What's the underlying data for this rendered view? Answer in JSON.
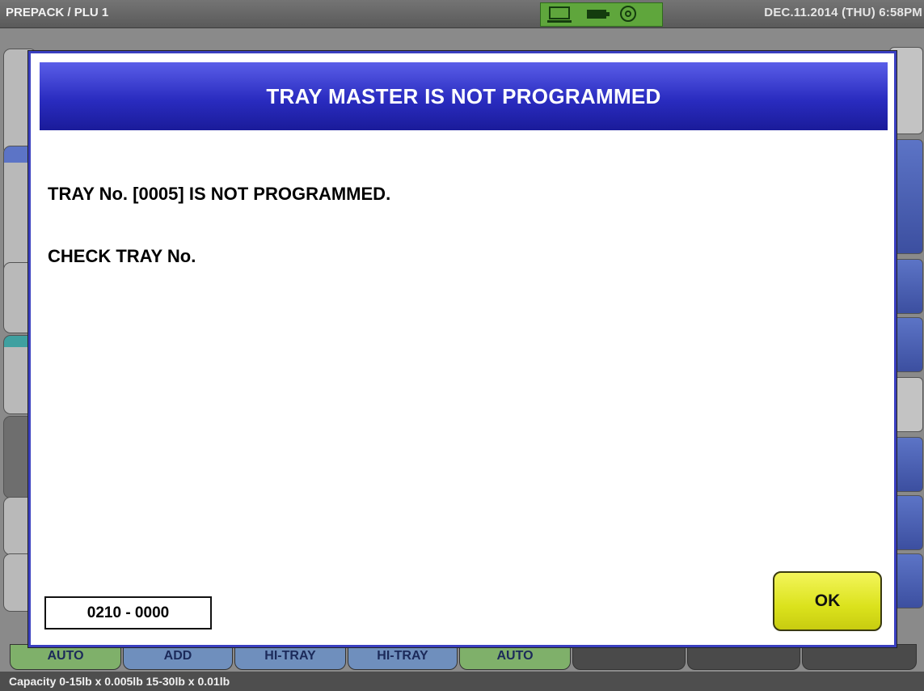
{
  "topbar": {
    "title": "PREPACK / PLU 1",
    "status_icons": [
      "monitor-icon",
      "battery-icon",
      "signal-icon"
    ],
    "datetime": "DEC.11.2014 (THU)   6:58PM"
  },
  "dialog": {
    "title": "TRAY MASTER IS NOT PROGRAMMED",
    "line1": "TRAY No. [0005] IS NOT PROGRAMMED.",
    "line2": "CHECK TRAY No.",
    "code": "0210 - 0000",
    "ok_label": "OK"
  },
  "bottom_tabs": [
    {
      "label": "AUTO",
      "color": "green"
    },
    {
      "label": "ADD",
      "color": "blue"
    },
    {
      "label": "HI-TRAY",
      "color": "blue"
    },
    {
      "label": "HI-TRAY",
      "color": "blue"
    },
    {
      "label": "AUTO",
      "color": "green"
    }
  ],
  "capacity": "Capacity 0-15lb x 0.005lb  15-30lb x 0.01lb",
  "colors": {
    "dialog_header": "#2a2cc0",
    "ok_button": "#dbe21c",
    "status_icons_bg": "#5fa63c"
  }
}
